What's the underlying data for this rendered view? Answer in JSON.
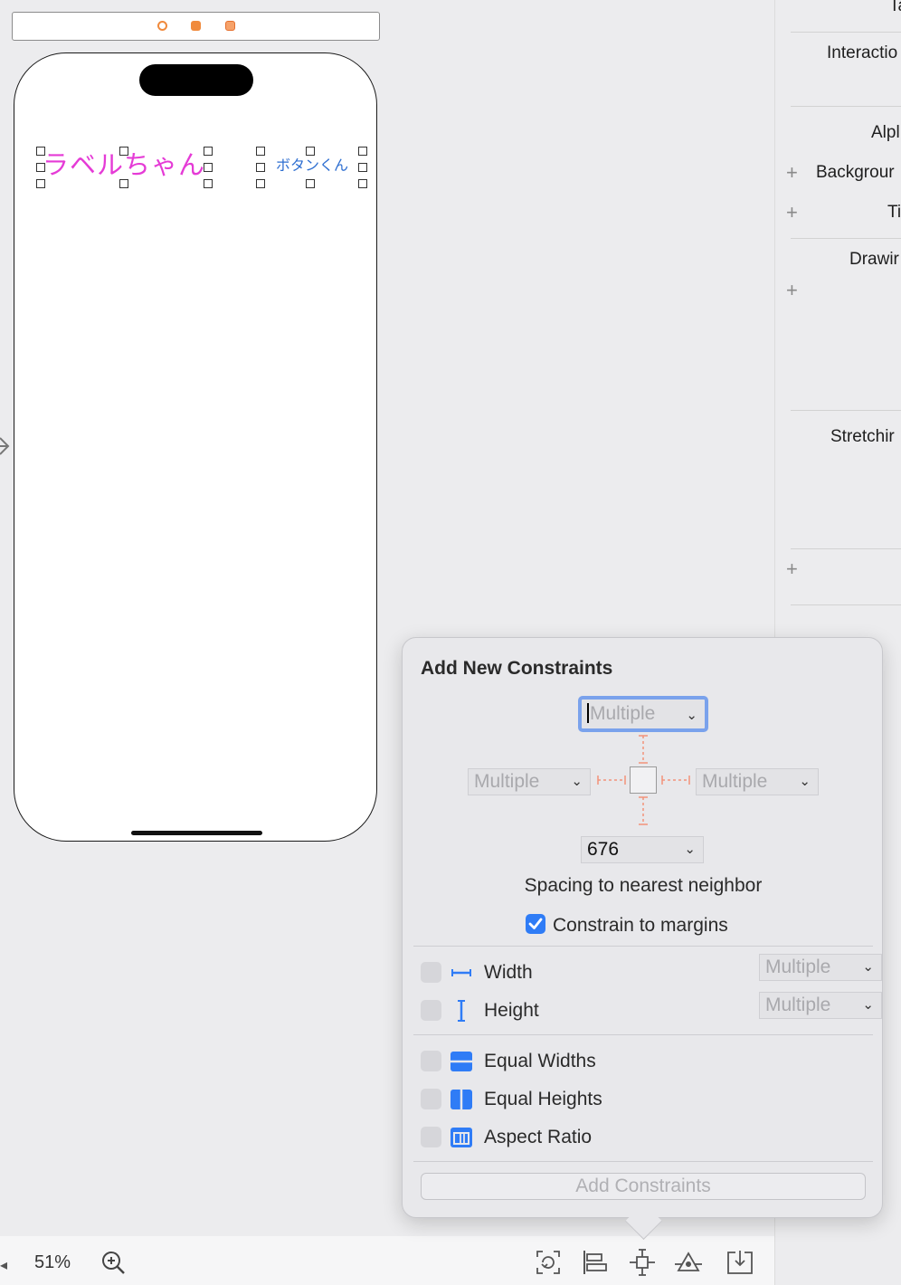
{
  "canvas": {
    "label_text": "ラベルちゃん",
    "button_text": "ボタンくん",
    "label_color": "#e53bd6",
    "button_color": "#2f6fd1"
  },
  "inspector": {
    "items": [
      {
        "label": "Ta"
      },
      {
        "label": "Interactio"
      },
      {
        "label": "Alpl"
      },
      {
        "label": "Backgrour"
      },
      {
        "label": "Ti"
      },
      {
        "label": "Drawir"
      },
      {
        "label": "Stretchir"
      }
    ]
  },
  "popover": {
    "title": "Add New Constraints",
    "top_value": "Multiple",
    "left_value": "Multiple",
    "right_value": "Multiple",
    "bottom_value": "676",
    "spacing_caption": "Spacing to nearest neighbor",
    "constrain_margins_label": "Constrain to margins",
    "constrain_margins_checked": true,
    "width_label": "Width",
    "width_value": "Multiple",
    "height_label": "Height",
    "height_value": "Multiple",
    "equal_widths_label": "Equal Widths",
    "equal_heights_label": "Equal Heights",
    "aspect_ratio_label": "Aspect Ratio",
    "add_button_label": "Add Constraints",
    "accent_color": "#2f7cf6",
    "strut_color": "#f2937a"
  },
  "bottom_bar": {
    "zoom_level": "51%"
  }
}
